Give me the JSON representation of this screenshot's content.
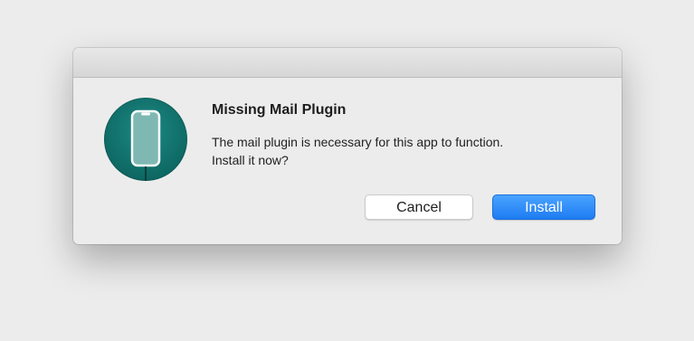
{
  "dialog": {
    "title": "Missing Mail Plugin",
    "message_line1": "The mail plugin is necessary for this app to function.",
    "message_line2": "Install it now?",
    "icon": "phone-app-icon",
    "buttons": {
      "cancel_label": "Cancel",
      "install_label": "Install"
    }
  },
  "colors": {
    "accent": "#1e7cf2",
    "icon_bg": "#0f6b66",
    "window_bg": "#ececec"
  }
}
